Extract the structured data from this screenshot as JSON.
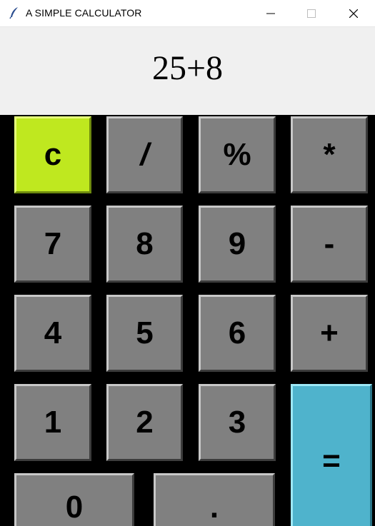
{
  "window": {
    "title": "A SIMPLE CALCULATOR"
  },
  "display": {
    "expression": "25+8"
  },
  "keys": {
    "clear": "c",
    "divide": "/",
    "percent": "%",
    "multiply": "*",
    "seven": "7",
    "eight": "8",
    "nine": "9",
    "minus": "-",
    "four": "4",
    "five": "5",
    "six": "6",
    "plus": "+",
    "one": "1",
    "two": "2",
    "three": "3",
    "equals": "=",
    "zero": "0",
    "dot": "."
  },
  "icons": {
    "app": "feather-icon",
    "minimize": "minimize-icon",
    "maximize": "maximize-icon",
    "close": "close-icon"
  },
  "colors": {
    "clear_key": "#bfe81f",
    "equals_key": "#4fb3cc",
    "digit_key": "#808080",
    "keypad_background": "#000000",
    "display_background": "#f0f0f0"
  }
}
